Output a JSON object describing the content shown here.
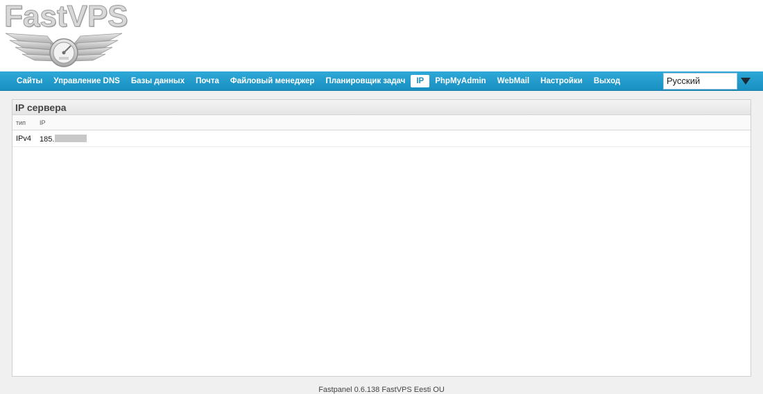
{
  "header": {
    "logo_text": "FastVPS"
  },
  "nav": {
    "items": [
      {
        "label": "Сайты"
      },
      {
        "label": "Управление DNS"
      },
      {
        "label": "Базы данных"
      },
      {
        "label": "Почта"
      },
      {
        "label": "Файловый менеджер"
      },
      {
        "label": "Планировщик задач"
      },
      {
        "label": "IP",
        "active": true
      },
      {
        "label": "PhpMyAdmin"
      },
      {
        "label": "WebMail"
      },
      {
        "label": "Настройки"
      },
      {
        "label": "Выход"
      }
    ]
  },
  "language": {
    "selected": "Русский",
    "icon": "chevron-down-icon"
  },
  "panel": {
    "title": "IP сервера",
    "columns": [
      "тип",
      "IP"
    ],
    "rows": [
      {
        "type": "IPv4",
        "ip": "185."
      }
    ]
  },
  "footer": {
    "text": "Fastpanel 0.6.138 FastVPS Eesti OU"
  },
  "colors": {
    "nav_bg": "#1f9acd",
    "nav_active_text": "#1a8fc3",
    "page_bg": "#f0f0f0"
  }
}
